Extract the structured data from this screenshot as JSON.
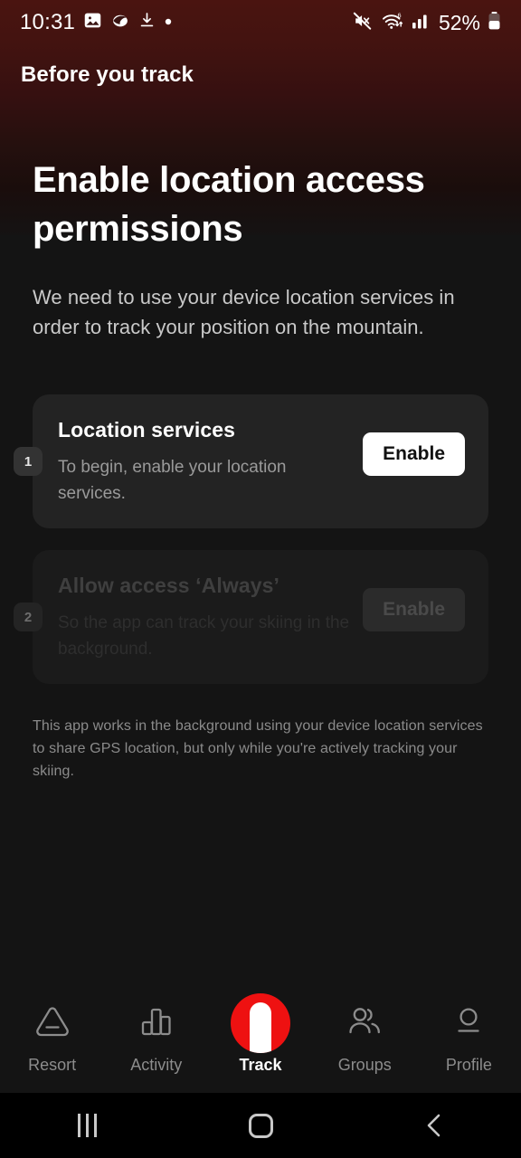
{
  "status_bar": {
    "time": "10:31",
    "left_icons": [
      "image-icon",
      "samsung-internet-icon",
      "download-icon",
      "dot-icon"
    ],
    "right_icons": [
      "mute-icon",
      "wifi-6-icon",
      "cellular-signal-icon"
    ],
    "battery_percent": "52%"
  },
  "header": {
    "title": "Before you track"
  },
  "main": {
    "headline": "Enable location access permissions",
    "subcopy": "We need to use your device location services in order to track your position on the mountain.",
    "steps": [
      {
        "number": "1",
        "title": "Location services",
        "subtitle": "To begin, enable your location services.",
        "button_label": "Enable",
        "enabled": true
      },
      {
        "number": "2",
        "title": "Allow access ‘Always’",
        "subtitle": "So the app can track your skiing in the background.",
        "button_label": "Enable",
        "enabled": false
      }
    ],
    "fineprint": "This app works in the background using your device location services to share GPS location, but only while you're actively tracking your skiing."
  },
  "tabbar": {
    "items": [
      {
        "label": "Resort",
        "icon": "mountain-icon",
        "active": false
      },
      {
        "label": "Activity",
        "icon": "bar-chart-icon",
        "active": false
      },
      {
        "label": "Track",
        "icon": "track-icon",
        "active": true
      },
      {
        "label": "Groups",
        "icon": "people-icon",
        "active": false
      },
      {
        "label": "Profile",
        "icon": "person-icon",
        "active": false
      }
    ]
  },
  "system_nav": {
    "recents_label": "recents-icon",
    "home_label": "home-icon",
    "back_label": "back-icon"
  },
  "colors": {
    "accent_red": "#ee1111",
    "gradient_top": "#4a1410",
    "page_background": "#141414",
    "card_background": "#232323"
  }
}
